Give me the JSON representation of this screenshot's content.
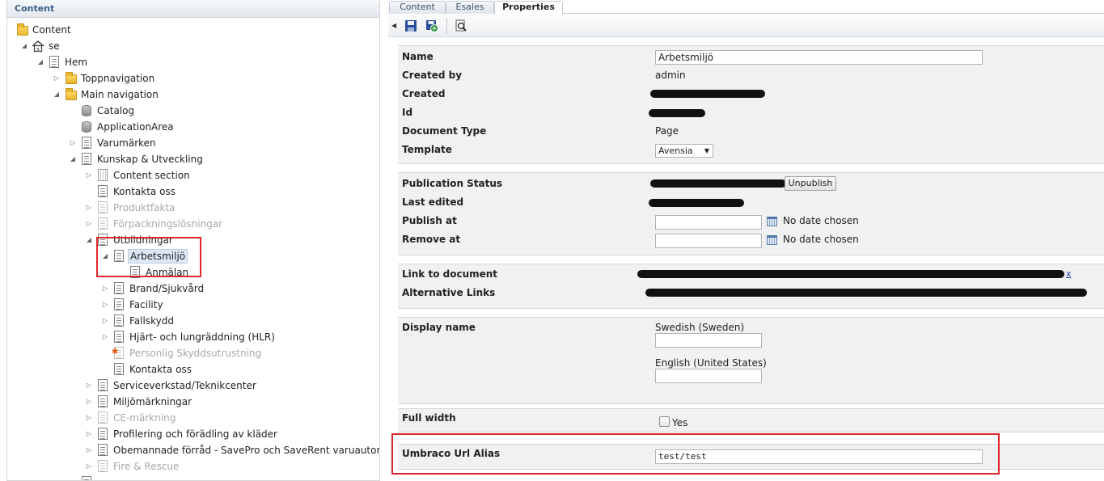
{
  "tree": {
    "header": "Content",
    "nodes": [
      {
        "label": "Content"
      },
      {
        "label": "se"
      },
      {
        "label": "Hem"
      },
      {
        "label": "Toppnavigation"
      },
      {
        "label": "Main navigation"
      },
      {
        "label": "Catalog"
      },
      {
        "label": "ApplicationArea"
      },
      {
        "label": "Varumärken"
      },
      {
        "label": "Kunskap & Utveckling"
      },
      {
        "label": "Content section"
      },
      {
        "label": "Kontakta oss"
      },
      {
        "label": "Produktfakta"
      },
      {
        "label": "Förpackningslösningar"
      },
      {
        "label": "Utbildningar"
      },
      {
        "label": "Arbetsmiljö"
      },
      {
        "label": "Anmälan"
      },
      {
        "label": "Brand/Sjukvård"
      },
      {
        "label": "Facility"
      },
      {
        "label": "Fallskydd"
      },
      {
        "label": "Hjärt- och lungräddning (HLR)"
      },
      {
        "label": "Personlig Skyddsutrustning"
      },
      {
        "label": "Kontakta oss"
      },
      {
        "label": "Serviceverkstad/Teknikcenter"
      },
      {
        "label": "Miljömärkningar"
      },
      {
        "label": "CE-märkning"
      },
      {
        "label": "Profilering och förädling av kläder"
      },
      {
        "label": "Obemannade förråd - SavePro och SaveRent varuautomat"
      },
      {
        "label": "Fire & Rescue"
      }
    ]
  },
  "tabs": [
    {
      "label": "Content"
    },
    {
      "label": "Esales"
    },
    {
      "label": "Properties"
    }
  ],
  "toolbar": {
    "save": "save-icon",
    "save_publish": "save-publish-icon",
    "preview": "preview-icon"
  },
  "properties": {
    "name_label": "Name",
    "name_value": "Arbetsmiljö",
    "created_by_label": "Created by",
    "created_by_value": "admin",
    "created_label": "Created",
    "id_label": "Id",
    "doctype_label": "Document Type",
    "doctype_value": "Page",
    "template_label": "Template",
    "template_value": "Avensia"
  },
  "publication": {
    "status_label": "Publication Status",
    "unpublish_label": "Unpublish",
    "last_edited_label": "Last edited",
    "publish_at_label": "Publish at",
    "publish_at_value": "No date chosen",
    "remove_at_label": "Remove at",
    "remove_at_value": "No date chosen"
  },
  "links": {
    "link_label": "Link to document",
    "alt_label": "Alternative Links",
    "link_tail": "x"
  },
  "display_name": {
    "label": "Display name",
    "swedish_label": "Swedish (Sweden)",
    "english_label": "English (United States)"
  },
  "full_width": {
    "label": "Full width",
    "checkbox_label": "Yes",
    "checked": false
  },
  "url_alias": {
    "label": "Umbraco Url Alias",
    "value": "test/test"
  }
}
